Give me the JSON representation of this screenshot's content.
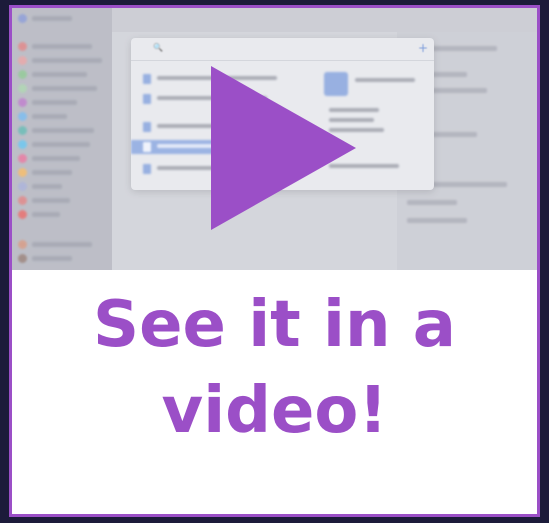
{
  "caption": {
    "line1": "See it in a",
    "line2": "video!"
  },
  "play_button": {
    "icon": "play-icon"
  },
  "colors": {
    "accent": "#9b4fc7",
    "background": "#1c1b3a",
    "thumbnail": "#cfd1d8"
  }
}
